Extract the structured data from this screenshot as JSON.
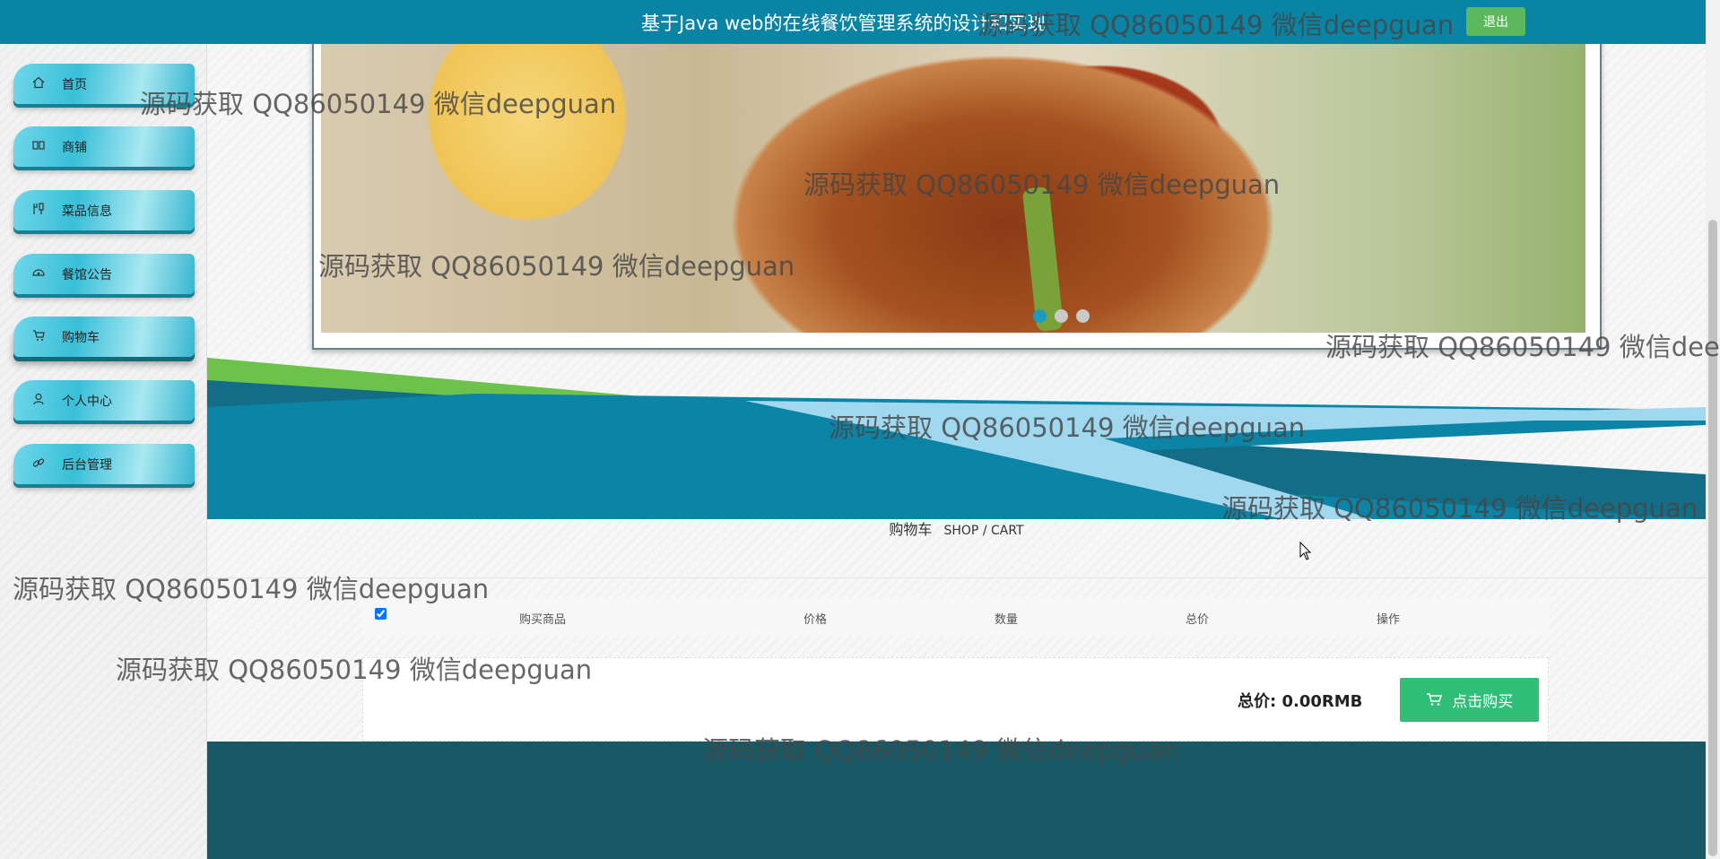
{
  "header": {
    "title": "基于Java web的在线餐饮管理系统的设计和实现",
    "logout_label": "退出"
  },
  "sidebar": {
    "items": [
      {
        "label": "首页",
        "icon": "home-icon"
      },
      {
        "label": "商铺",
        "icon": "shop-icon"
      },
      {
        "label": "菜品信息",
        "icon": "dish-icon"
      },
      {
        "label": "餐馆公告",
        "icon": "notice-icon"
      },
      {
        "label": "购物车",
        "icon": "cart-icon",
        "active": true
      },
      {
        "label": "个人中心",
        "icon": "user-icon"
      },
      {
        "label": "后台管理",
        "icon": "link-icon"
      }
    ]
  },
  "banner": {
    "slides": 3,
    "active_slide": 1
  },
  "cart": {
    "title": "购物车",
    "subtitle": "SHOP / CART",
    "columns": [
      "购买商品",
      "价格",
      "数量",
      "总价",
      "操作"
    ],
    "select_all": true,
    "items": [],
    "total_label": "总价: 0.00RMB",
    "buy_label": "点击购买"
  },
  "watermark": {
    "text": "源码获取 QQ86050149 微信deepguan"
  },
  "colors": {
    "topbar": "#0a84a4",
    "logout": "#5cb85c",
    "buy": "#2fbf77",
    "footer": "#175a66",
    "nav": "#39bfd8"
  }
}
